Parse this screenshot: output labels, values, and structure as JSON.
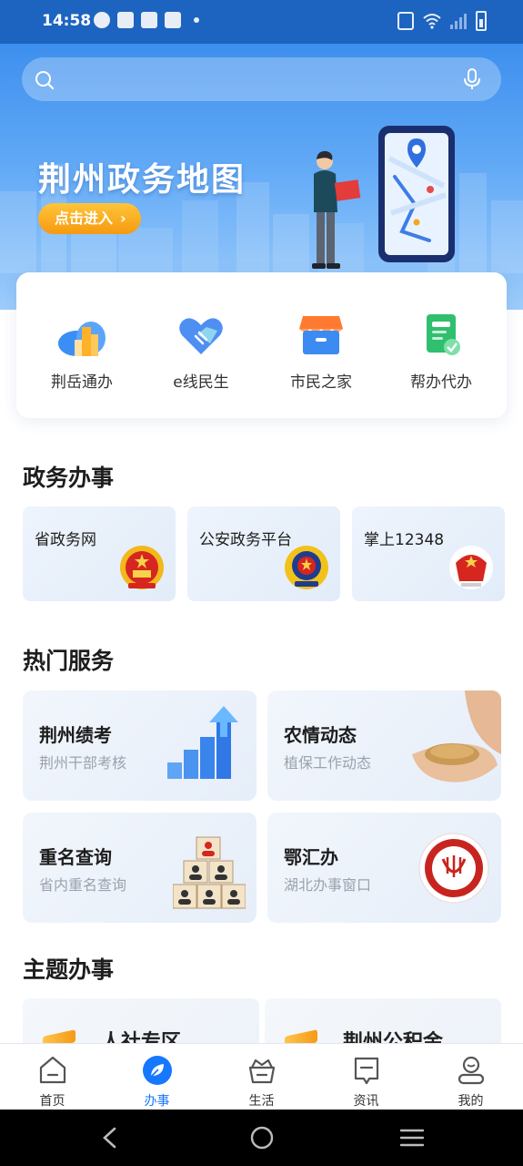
{
  "status_bar": {
    "time": "14:58"
  },
  "banner": {
    "title": "荆州政务地图",
    "enter_label": "点击进入",
    "enter_chevron": "›"
  },
  "quick_entries": [
    {
      "label": "荆岳通办",
      "icon": "buildings-icon"
    },
    {
      "label": "e线民生",
      "icon": "heart-handshake-icon"
    },
    {
      "label": "市民之家",
      "icon": "store-icon"
    },
    {
      "label": "帮办代办",
      "icon": "document-check-icon"
    }
  ],
  "sections": {
    "gov": "政务办事",
    "hot": "热门服务",
    "topic": "主题办事"
  },
  "gov_cards": [
    {
      "label": "省政务网",
      "icon": "national-emblem-icon"
    },
    {
      "label": "公安政务平台",
      "icon": "police-emblem-icon"
    },
    {
      "label": "掌上12348",
      "icon": "court-emblem-icon"
    }
  ],
  "hot_services": [
    {
      "title": "荆州绩考",
      "subtitle": "荆州干部考核",
      "icon": "bar-growth-icon"
    },
    {
      "title": "农情动态",
      "subtitle": "植保工作动态",
      "icon": "grain-hands-icon"
    },
    {
      "title": "重名查询",
      "subtitle": "省内重名查询",
      "icon": "people-blocks-icon"
    },
    {
      "title": "鄂汇办",
      "subtitle": "湖北办事窗口",
      "icon": "ehuiban-logo-icon"
    }
  ],
  "topics": [
    {
      "label": "人社专区"
    },
    {
      "label": "荆州公积金"
    }
  ],
  "bottom_nav": [
    {
      "label": "首页",
      "icon": "home-icon",
      "active": false
    },
    {
      "label": "办事",
      "icon": "leaf-icon",
      "active": true
    },
    {
      "label": "生活",
      "icon": "basket-icon",
      "active": false
    },
    {
      "label": "资讯",
      "icon": "news-icon",
      "active": false
    },
    {
      "label": "我的",
      "icon": "profile-icon",
      "active": false
    }
  ],
  "colors": {
    "status_bar": "#1c64c0",
    "banner_top": "#3d8fee",
    "accent": "#1677ff",
    "enter_button": "#f59a10"
  }
}
